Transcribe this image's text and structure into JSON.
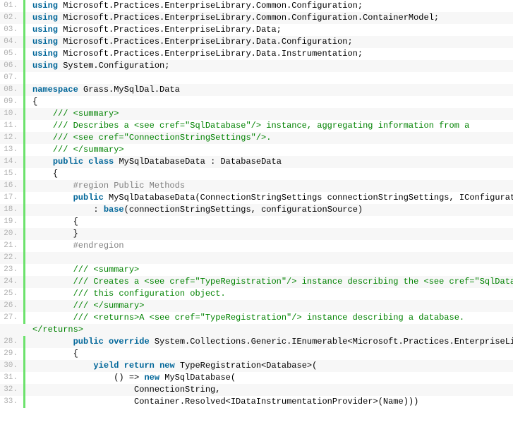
{
  "lines": [
    {
      "n": "01.",
      "parts": [
        {
          "c": "kw",
          "t": "using"
        },
        {
          "c": "pl",
          "t": " Microsoft.Practices.EnterpriseLibrary.Common.Configuration;"
        }
      ],
      "indent": 0
    },
    {
      "n": "02.",
      "parts": [
        {
          "c": "kw",
          "t": "using"
        },
        {
          "c": "pl",
          "t": " Microsoft.Practices.EnterpriseLibrary.Common.Configuration.ContainerModel;"
        }
      ],
      "indent": 0
    },
    {
      "n": "03.",
      "parts": [
        {
          "c": "kw",
          "t": "using"
        },
        {
          "c": "pl",
          "t": " Microsoft.Practices.EnterpriseLibrary.Data;"
        }
      ],
      "indent": 0
    },
    {
      "n": "04.",
      "parts": [
        {
          "c": "kw",
          "t": "using"
        },
        {
          "c": "pl",
          "t": " Microsoft.Practices.EnterpriseLibrary.Data.Configuration;"
        }
      ],
      "indent": 0
    },
    {
      "n": "05.",
      "parts": [
        {
          "c": "kw",
          "t": "using"
        },
        {
          "c": "pl",
          "t": " Microsoft.Practices.EnterpriseLibrary.Data.Instrumentation;"
        }
      ],
      "indent": 0
    },
    {
      "n": "06.",
      "parts": [
        {
          "c": "kw",
          "t": "using"
        },
        {
          "c": "pl",
          "t": " System.Configuration;"
        }
      ],
      "indent": 0
    },
    {
      "n": "07.",
      "parts": [
        {
          "c": "pl",
          "t": " "
        }
      ],
      "indent": 0
    },
    {
      "n": "08.",
      "parts": [
        {
          "c": "kw",
          "t": "namespace"
        },
        {
          "c": "pl",
          "t": " Grass.MySqlDal.Data"
        }
      ],
      "indent": 0
    },
    {
      "n": "09.",
      "parts": [
        {
          "c": "pl",
          "t": "{"
        }
      ],
      "indent": 0
    },
    {
      "n": "10.",
      "parts": [
        {
          "c": "cm",
          "t": "/// <summary>"
        }
      ],
      "indent": 1
    },
    {
      "n": "11.",
      "parts": [
        {
          "c": "cm",
          "t": "/// Describes a <see cref=\"SqlDatabase\"/> instance, aggregating information from a"
        }
      ],
      "indent": 1
    },
    {
      "n": "12.",
      "parts": [
        {
          "c": "cm",
          "t": "/// <see cref=\"ConnectionStringSettings\"/>."
        }
      ],
      "indent": 1
    },
    {
      "n": "13.",
      "parts": [
        {
          "c": "cm",
          "t": "/// </summary>"
        }
      ],
      "indent": 1
    },
    {
      "n": "14.",
      "parts": [
        {
          "c": "kw",
          "t": "public"
        },
        {
          "c": "pl",
          "t": " "
        },
        {
          "c": "kw",
          "t": "class"
        },
        {
          "c": "pl",
          "t": " MySqlDatabaseData : DatabaseData"
        }
      ],
      "indent": 1
    },
    {
      "n": "15.",
      "parts": [
        {
          "c": "pl",
          "t": "{"
        }
      ],
      "indent": 1
    },
    {
      "n": "16.",
      "parts": [
        {
          "c": "pp",
          "t": "#region Public Methods"
        }
      ],
      "indent": 2
    },
    {
      "n": "17.",
      "parts": [
        {
          "c": "kw",
          "t": "public"
        },
        {
          "c": "pl",
          "t": " MySqlDatabaseData(ConnectionStringSettings connectionStringSettings, IConfigurati"
        }
      ],
      "indent": 2
    },
    {
      "n": "18.",
      "parts": [
        {
          "c": "pl",
          "t": ": "
        },
        {
          "c": "kw",
          "t": "base"
        },
        {
          "c": "pl",
          "t": "(connectionStringSettings, configurationSource)"
        }
      ],
      "indent": 3
    },
    {
      "n": "19.",
      "parts": [
        {
          "c": "pl",
          "t": "{"
        }
      ],
      "indent": 2
    },
    {
      "n": "20.",
      "parts": [
        {
          "c": "pl",
          "t": "}"
        }
      ],
      "indent": 2
    },
    {
      "n": "21.",
      "parts": [
        {
          "c": "pp",
          "t": "#endregion"
        }
      ],
      "indent": 2
    },
    {
      "n": "22.",
      "parts": [
        {
          "c": "pl",
          "t": " "
        }
      ],
      "indent": 0
    },
    {
      "n": "23.",
      "parts": [
        {
          "c": "cm",
          "t": "/// <summary>"
        }
      ],
      "indent": 2
    },
    {
      "n": "24.",
      "parts": [
        {
          "c": "cm",
          "t": "/// Creates a <see cref=\"TypeRegistration\"/> instance describing the <see cref=\"SqlDatab"
        }
      ],
      "indent": 2
    },
    {
      "n": "25.",
      "parts": [
        {
          "c": "cm",
          "t": "/// this configuration object."
        }
      ],
      "indent": 2
    },
    {
      "n": "26.",
      "parts": [
        {
          "c": "cm",
          "t": "/// </summary>"
        }
      ],
      "indent": 2
    },
    {
      "n": "27.",
      "parts": [
        {
          "c": "cm",
          "t": "/// <returns>A <see cref=\"TypeRegistration\"/> instance describing a database."
        }
      ],
      "indent": 2
    },
    {
      "n": "",
      "parts": [
        {
          "c": "cm",
          "t": "</returns>"
        }
      ],
      "indent": 0,
      "nogutter": true
    },
    {
      "n": "28.",
      "parts": [
        {
          "c": "kw",
          "t": "public"
        },
        {
          "c": "pl",
          "t": " "
        },
        {
          "c": "kw",
          "t": "override"
        },
        {
          "c": "pl",
          "t": " System.Collections.Generic.IEnumerable<Microsoft.Practices.EnterpriseLib"
        }
      ],
      "indent": 2
    },
    {
      "n": "29.",
      "parts": [
        {
          "c": "pl",
          "t": "{"
        }
      ],
      "indent": 2
    },
    {
      "n": "30.",
      "parts": [
        {
          "c": "kw",
          "t": "yield"
        },
        {
          "c": "pl",
          "t": " "
        },
        {
          "c": "kw",
          "t": "return"
        },
        {
          "c": "pl",
          "t": " "
        },
        {
          "c": "kw",
          "t": "new"
        },
        {
          "c": "pl",
          "t": " TypeRegistration<Database>("
        }
      ],
      "indent": 3
    },
    {
      "n": "31.",
      "parts": [
        {
          "c": "pl",
          "t": "() => "
        },
        {
          "c": "kw",
          "t": "new"
        },
        {
          "c": "pl",
          "t": " MySqlDatabase("
        }
      ],
      "indent": 4
    },
    {
      "n": "32.",
      "parts": [
        {
          "c": "pl",
          "t": "ConnectionString,"
        }
      ],
      "indent": 5
    },
    {
      "n": "33.",
      "parts": [
        {
          "c": "pl",
          "t": "Container.Resolved<IDataInstrumentationProvider>(Name)))"
        }
      ],
      "indent": 5
    }
  ]
}
